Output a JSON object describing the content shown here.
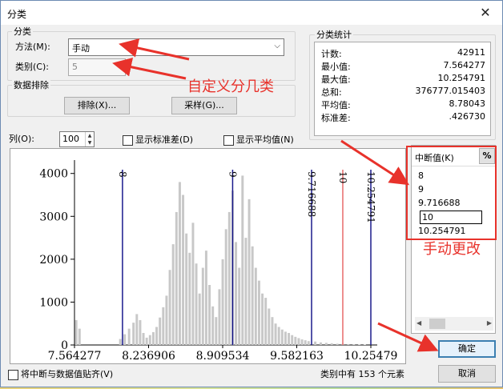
{
  "window": {
    "title": "分类",
    "close_glyph": "✕"
  },
  "classification": {
    "legend": "分类",
    "method_label": "方法(M):",
    "method_value": "手动",
    "classes_label": "类别(C):",
    "classes_value": "5"
  },
  "exclusion": {
    "legend": "数据排除",
    "exclude_button": "排除(X)...",
    "sample_button": "采样(G)..."
  },
  "stats": {
    "legend": "分类统计",
    "rows": [
      {
        "k": "计数:",
        "v": "42911"
      },
      {
        "k": "最小值:",
        "v": "7.564277"
      },
      {
        "k": "最大值:",
        "v": "10.254791"
      },
      {
        "k": "总和:",
        "v": "376777.015403"
      },
      {
        "k": "平均值:",
        "v": "8.78043"
      },
      {
        "k": "标准差:",
        "v": ".426730"
      }
    ]
  },
  "options": {
    "columns_label": "列(O):",
    "columns_value": "100",
    "show_std_label": "显示标准差(D)",
    "show_mean_label": "显示平均值(N)",
    "snap_label": "将中断与数据值贴齐(V)"
  },
  "breaks": {
    "header": "中断值(K)",
    "percent_button": "%",
    "values": [
      "8",
      "9",
      "9.716688",
      "10",
      "10.254791"
    ],
    "editing_index": 3
  },
  "footer": {
    "count_prefix": "类别中有",
    "count_value": "153",
    "count_suffix": "个元素",
    "ok_button": "确定",
    "cancel_button": "取消"
  },
  "annotations": {
    "custom_classes": "自定义分几类",
    "manual_change": "手动更改"
  },
  "colors": {
    "annotation_red": "#e8322b",
    "break_line_blue": "#1a1a8c",
    "break_line_selected": "#e86a6a",
    "bar_gray": "#c8c8c8"
  },
  "chart_data": {
    "type": "bar",
    "title": "",
    "xlabel": "",
    "ylabel": "",
    "x_ticks": [
      "7.564277",
      "8.236906",
      "8.909534",
      "9.582163",
      "10.25479"
    ],
    "y_ticks": [
      "0",
      "1000",
      "2000",
      "3000",
      "4000"
    ],
    "xlim": [
      7.564277,
      10.254791
    ],
    "ylim": [
      0,
      4200
    ],
    "break_lines": [
      {
        "value": 8,
        "label": "8"
      },
      {
        "value": 9,
        "label": "9"
      },
      {
        "value": 9.716688,
        "label": "9.716688"
      },
      {
        "value": 10,
        "label": "10",
        "selected": true
      },
      {
        "value": 10.254791,
        "label": "10.254791"
      }
    ],
    "bars": [
      {
        "x": 7.58,
        "y": 580
      },
      {
        "x": 7.61,
        "y": 380
      },
      {
        "x": 7.98,
        "y": 140
      },
      {
        "x": 8.02,
        "y": 250
      },
      {
        "x": 8.06,
        "y": 380
      },
      {
        "x": 8.1,
        "y": 520
      },
      {
        "x": 8.13,
        "y": 720
      },
      {
        "x": 8.16,
        "y": 580
      },
      {
        "x": 8.19,
        "y": 280
      },
      {
        "x": 8.22,
        "y": 170
      },
      {
        "x": 8.25,
        "y": 230
      },
      {
        "x": 8.28,
        "y": 300
      },
      {
        "x": 8.31,
        "y": 420
      },
      {
        "x": 8.34,
        "y": 640
      },
      {
        "x": 8.37,
        "y": 880
      },
      {
        "x": 8.4,
        "y": 1150
      },
      {
        "x": 8.43,
        "y": 1750
      },
      {
        "x": 8.46,
        "y": 2350
      },
      {
        "x": 8.49,
        "y": 3100
      },
      {
        "x": 8.52,
        "y": 3800
      },
      {
        "x": 8.55,
        "y": 3500
      },
      {
        "x": 8.58,
        "y": 2600
      },
      {
        "x": 8.61,
        "y": 2150
      },
      {
        "x": 8.64,
        "y": 2850
      },
      {
        "x": 8.67,
        "y": 1900
      },
      {
        "x": 8.7,
        "y": 1200
      },
      {
        "x": 8.73,
        "y": 1800
      },
      {
        "x": 8.76,
        "y": 2200
      },
      {
        "x": 8.79,
        "y": 1400
      },
      {
        "x": 8.82,
        "y": 900
      },
      {
        "x": 8.85,
        "y": 650
      },
      {
        "x": 8.88,
        "y": 1300
      },
      {
        "x": 8.91,
        "y": 2000
      },
      {
        "x": 8.94,
        "y": 2700
      },
      {
        "x": 8.97,
        "y": 3100
      },
      {
        "x": 9.0,
        "y": 3600
      },
      {
        "x": 9.03,
        "y": 2400
      },
      {
        "x": 9.06,
        "y": 1800
      },
      {
        "x": 9.09,
        "y": 3950
      },
      {
        "x": 9.12,
        "y": 2500
      },
      {
        "x": 9.15,
        "y": 3400
      },
      {
        "x": 9.18,
        "y": 2300
      },
      {
        "x": 9.21,
        "y": 1800
      },
      {
        "x": 9.24,
        "y": 1500
      },
      {
        "x": 9.27,
        "y": 1200
      },
      {
        "x": 9.3,
        "y": 1100
      },
      {
        "x": 9.33,
        "y": 850
      },
      {
        "x": 9.36,
        "y": 650
      },
      {
        "x": 9.39,
        "y": 500
      },
      {
        "x": 9.42,
        "y": 420
      },
      {
        "x": 9.45,
        "y": 360
      },
      {
        "x": 9.48,
        "y": 310
      },
      {
        "x": 9.51,
        "y": 280
      },
      {
        "x": 9.54,
        "y": 230
      },
      {
        "x": 9.57,
        "y": 190
      },
      {
        "x": 9.6,
        "y": 160
      },
      {
        "x": 9.63,
        "y": 130
      },
      {
        "x": 9.66,
        "y": 110
      },
      {
        "x": 9.69,
        "y": 90
      },
      {
        "x": 9.75,
        "y": 80
      },
      {
        "x": 9.8,
        "y": 60
      },
      {
        "x": 9.85,
        "y": 50
      },
      {
        "x": 9.9,
        "y": 40
      },
      {
        "x": 9.95,
        "y": 30
      },
      {
        "x": 10.0,
        "y": 25
      },
      {
        "x": 10.05,
        "y": 20
      },
      {
        "x": 10.1,
        "y": 15
      },
      {
        "x": 10.15,
        "y": 12
      },
      {
        "x": 10.2,
        "y": 10
      }
    ]
  }
}
